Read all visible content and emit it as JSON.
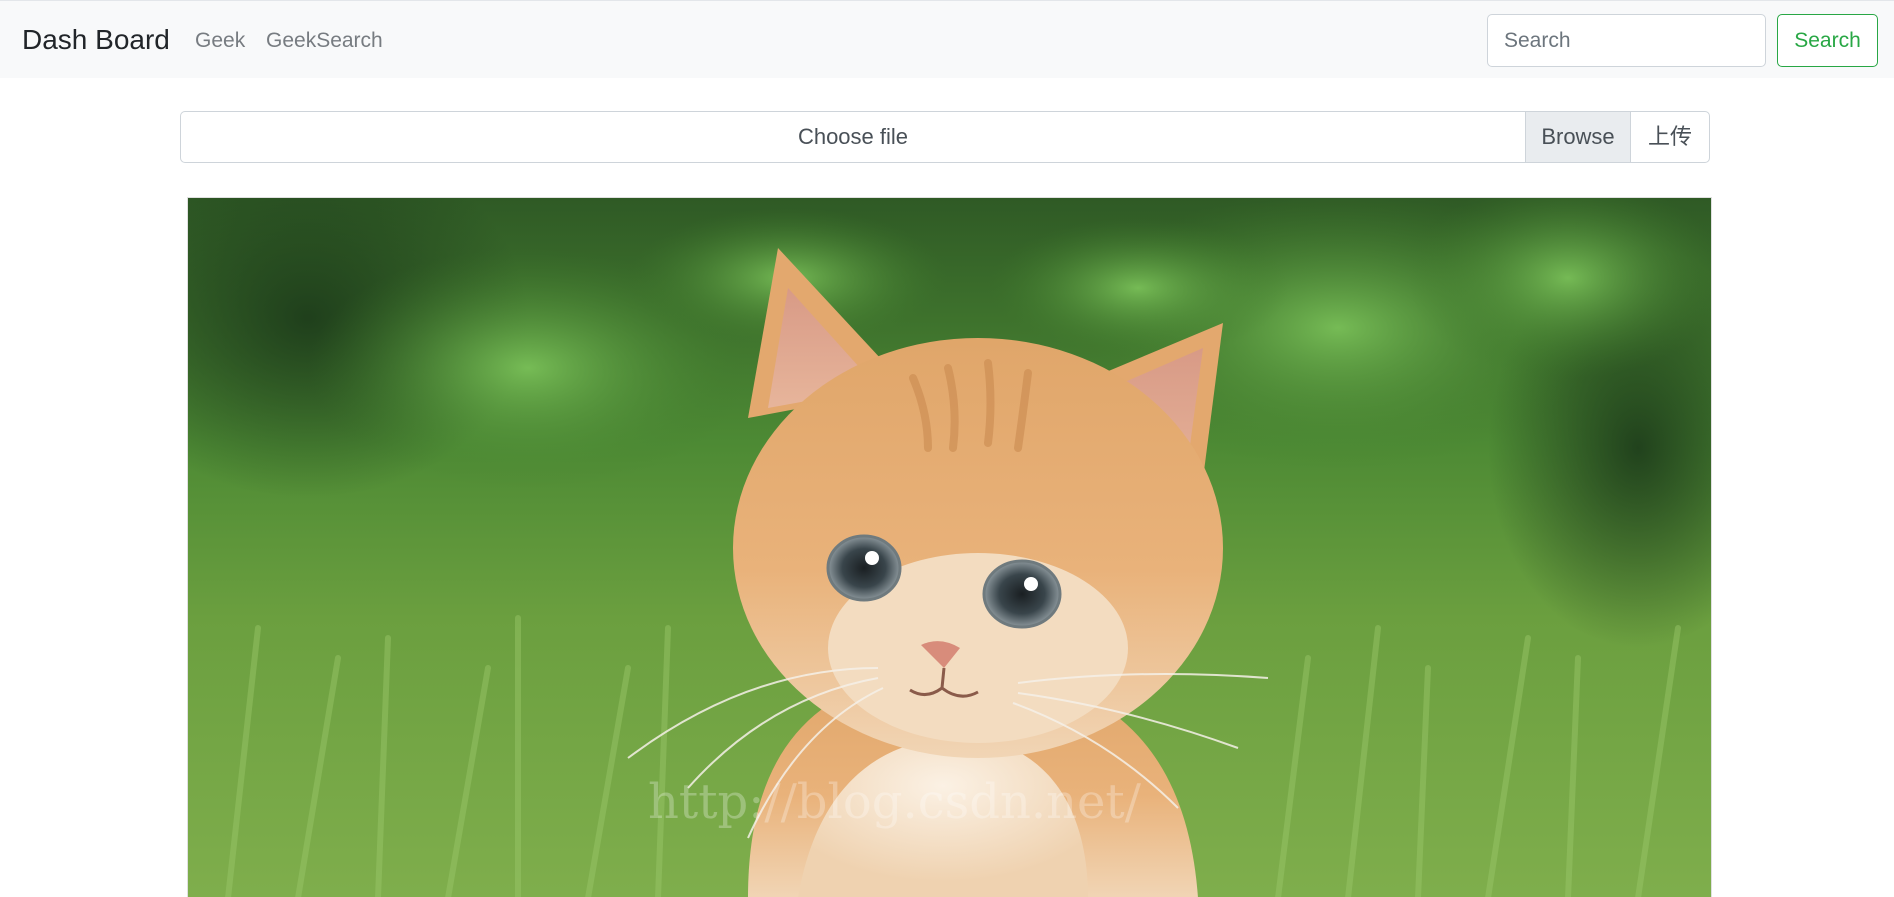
{
  "navbar": {
    "brand": "Dash Board",
    "links": [
      {
        "label": "Geek"
      },
      {
        "label": "GeekSearch"
      }
    ],
    "search": {
      "placeholder": "Search",
      "value": "",
      "button_label": "Search"
    },
    "accent_color": "#28a745"
  },
  "upload": {
    "file_label": "Choose file",
    "browse_label": "Browse",
    "upload_label": "上传"
  },
  "image": {
    "subject": "orange-kitten-on-grass",
    "watermark": "http://blog.csdn.net/"
  },
  "icons": {
    "image": "photo-icon"
  }
}
